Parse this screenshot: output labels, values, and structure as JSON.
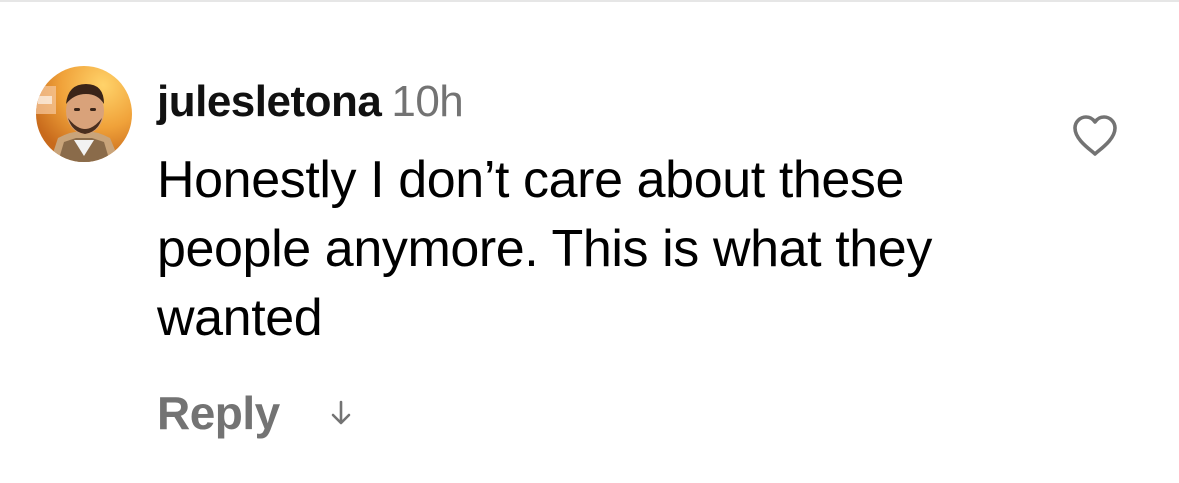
{
  "comment": {
    "username": "julesletona",
    "timestamp": "10h",
    "text": "Honestly I don’t care about these people anymore. This is what they wanted",
    "reply_label": "Reply"
  },
  "icons": {
    "like": "heart-outline-icon",
    "translate": "arrow-down-icon"
  },
  "colors": {
    "text_primary": "#000000",
    "text_secondary": "#737373",
    "background": "#ffffff"
  }
}
